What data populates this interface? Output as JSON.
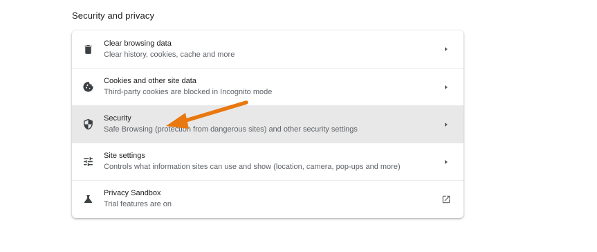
{
  "section": {
    "title": "Security and privacy"
  },
  "rows": [
    {
      "label": "Clear browsing data",
      "sublabel": "Clear history, cookies, cache and more",
      "icon": "trash-icon",
      "action": "chevron-right"
    },
    {
      "label": "Cookies and other site data",
      "sublabel": "Third-party cookies are blocked in Incognito mode",
      "icon": "cookie-icon",
      "action": "chevron-right"
    },
    {
      "label": "Security",
      "sublabel": "Safe Browsing (protection from dangerous sites) and other security settings",
      "icon": "shield-icon",
      "action": "chevron-right",
      "highlighted": true
    },
    {
      "label": "Site settings",
      "sublabel": "Controls what information sites can use and show (location, camera, pop-ups and more)",
      "icon": "sliders-icon",
      "action": "chevron-right"
    },
    {
      "label": "Privacy Sandbox",
      "sublabel": "Trial features are on",
      "icon": "flask-icon",
      "action": "external-link"
    }
  ],
  "colors": {
    "annotation_arrow": "#e8780f",
    "highlight_row": "#e8e8e8",
    "text_primary": "#202124",
    "text_secondary": "#5f6368"
  }
}
